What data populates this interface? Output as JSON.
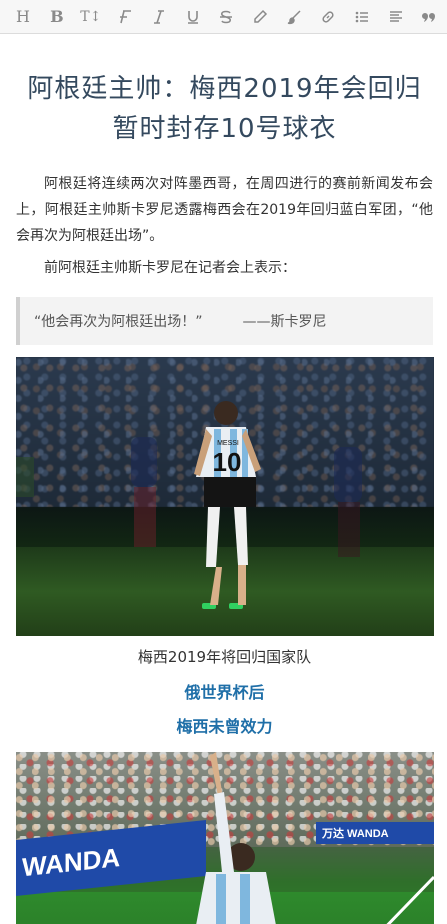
{
  "toolbar": {
    "heading_label": "H",
    "bold_label": "B",
    "text_size_label": "T↕"
  },
  "article": {
    "title": "阿根廷主帅：梅西2019年会回归暂时封存10号球衣",
    "paragraph1": "阿根廷将连续两次对阵墨西哥，在周四进行的赛前新闻发布会上，阿根廷主帅斯卡罗尼透露梅西会在2019年回归蓝白军团，“他会再次为阿根廷出场”。",
    "paragraph2": "前阿根廷主帅斯卡罗尼在记者会上表示：",
    "quote_text": "“他会再次为阿根廷出场！”",
    "quote_author": "——斯卡罗尼",
    "photo1_jersey_name": "MESSI",
    "photo1_jersey_number": "10",
    "caption1": "梅西2019年将回归国家队",
    "subheading1": "俄世界杯后",
    "subheading2": "梅西未曾效力",
    "photo2_banner_left": "WANDA",
    "photo2_banner_right": "万达 WANDA"
  },
  "colors": {
    "title": "#34495e",
    "subheading": "#1f6fa8",
    "quote_bg": "#f3f3f3",
    "quote_border": "#d0d0d0",
    "toolbar_bg": "#f7f7f7",
    "icon": "#8a8a8a"
  },
  "icons": [
    "heading-icon",
    "bold-icon",
    "text-size-icon",
    "font-icon",
    "italic-icon",
    "underline-icon",
    "strikethrough-icon",
    "highlighter-icon",
    "brush-icon",
    "link-icon",
    "bullet-list-icon",
    "align-icon",
    "quote-icon"
  ]
}
